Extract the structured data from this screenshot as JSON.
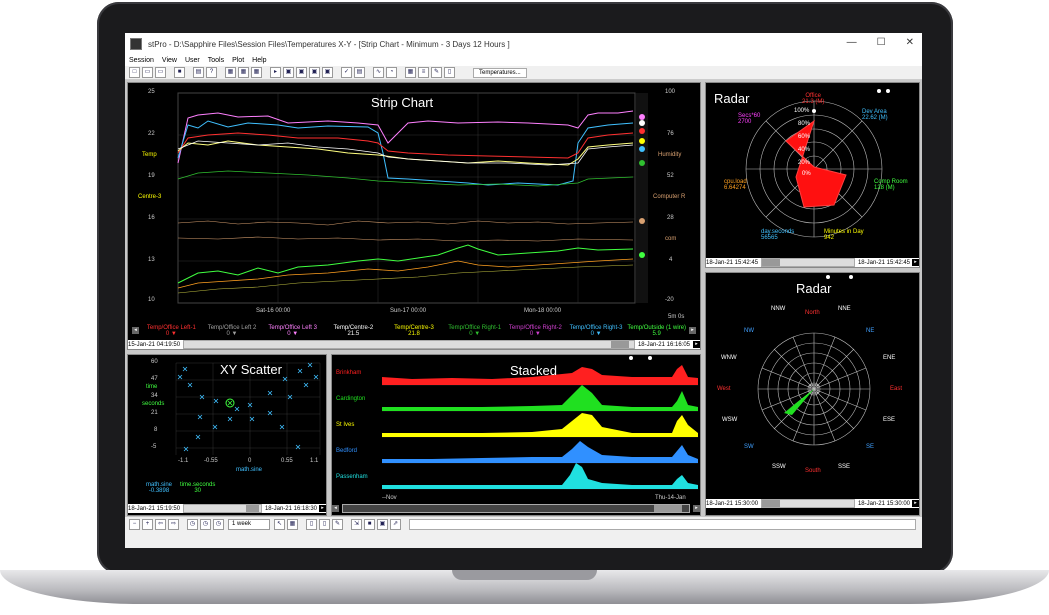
{
  "window": {
    "title": "stPro - D:\\Sapphire Files\\Session Files\\Temperatures X-Y - [Strip Chart - Minimum - 3 Days 12 Hours ]",
    "min": "—",
    "max": "☐",
    "close": "✕"
  },
  "menu": [
    "Session",
    "View",
    "User",
    "Tools",
    "Plot",
    "Help"
  ],
  "toolbar": {
    "tab_label": "Temperatures..."
  },
  "strip": {
    "title": "Strip Chart",
    "y_left_ticks": [
      "25",
      "22",
      "19",
      "16",
      "13",
      "10"
    ],
    "y_right_ticks": [
      "100",
      "76",
      "52",
      "28",
      "4",
      "-20"
    ],
    "left_labels": [
      {
        "text": "Temp",
        "color": "#ffff00"
      },
      {
        "text": "Centre-3",
        "color": "#ffff00"
      }
    ],
    "right_labels": [
      {
        "text": "Humidity",
        "color": "#d8a070"
      },
      {
        "text": "Computer R",
        "color": "#d8a070"
      },
      {
        "text": "com",
        "color": "#d8a070"
      }
    ],
    "x_ticks": [
      "Sat-16 00:00",
      "Sun-17 00:00",
      "Mon-18 00:00"
    ],
    "scale_label": "5m 0s",
    "legend": [
      {
        "name": "Temp/Office Left-1",
        "value": "0 ▼",
        "color": "#ff3030"
      },
      {
        "name": "Temp/Office Left 2",
        "value": "0 ▼",
        "color": "#a0a0a0"
      },
      {
        "name": "Temp/Office Left 3",
        "value": "0 ▼",
        "color": "#ff80ff"
      },
      {
        "name": "Temp/Centre-2",
        "value": "21.5",
        "color": "#ffffff"
      },
      {
        "name": "Temp/Centre-3",
        "value": "21.8",
        "color": "#ffff00"
      },
      {
        "name": "Temp/Office Right-1",
        "value": "0 ▼",
        "color": "#30c030"
      },
      {
        "name": "Temp/Office Right-2",
        "value": "0 ▼",
        "color": "#d040d0"
      },
      {
        "name": "Temp/Office Right-3",
        "value": "0 ▼",
        "color": "#40c0ff"
      },
      {
        "name": "Temp/Outside (1 wire)",
        "value": "5.9",
        "color": "#40ff40"
      }
    ],
    "start_time": "15-Jan-21 04:19:50",
    "end_time": "18-Jan-21 16:16:05"
  },
  "radar1": {
    "title": "Radar",
    "rings": [
      "100%",
      "80%",
      "60%",
      "40%",
      "20%",
      "0%"
    ],
    "labels": [
      {
        "name": "Office",
        "value": "21.3 (M)",
        "color": "#ff3030"
      },
      {
        "name": "Dev Area",
        "value": "22.62 (M)",
        "color": "#40c0ff"
      },
      {
        "name": "Comp Room",
        "value": "128 (M)",
        "color": "#40ff40"
      },
      {
        "name": "Minutes in Day",
        "value": "942",
        "color": "#ffff00"
      },
      {
        "name": "day.seconds",
        "value": "56565",
        "color": "#40c0ff"
      },
      {
        "name": "cpu.load",
        "value": "6.64274",
        "color": "#ffa020"
      },
      {
        "name": "Secs*60",
        "value": "2700",
        "color": "#ff40ff"
      }
    ],
    "start_time": "18-Jan-21 15:42:45",
    "end_time": "18-Jan-21 15:42:45"
  },
  "radar2": {
    "title": "Radar",
    "compass": [
      {
        "text": "North",
        "color": "#ff3030"
      },
      {
        "text": "NNE",
        "color": "#ffffff"
      },
      {
        "text": "NE",
        "color": "#40a0ff"
      },
      {
        "text": "ENE",
        "color": "#ffffff"
      },
      {
        "text": "East",
        "color": "#ff3030"
      },
      {
        "text": "ESE",
        "color": "#ffffff"
      },
      {
        "text": "SE",
        "color": "#40a0ff"
      },
      {
        "text": "SSE",
        "color": "#ffffff"
      },
      {
        "text": "South",
        "color": "#ff3030"
      },
      {
        "text": "SSW",
        "color": "#ffffff"
      },
      {
        "text": "SW",
        "color": "#40a0ff"
      },
      {
        "text": "WSW",
        "color": "#ffffff"
      },
      {
        "text": "West",
        "color": "#ff3030"
      },
      {
        "text": "WNW",
        "color": "#ffffff"
      },
      {
        "text": "NW",
        "color": "#40a0ff"
      },
      {
        "text": "NNW",
        "color": "#ffffff"
      }
    ],
    "start_time": "18-Jan-21 15:30:00",
    "end_time": "18-Jan-21 15:30:00"
  },
  "scatter": {
    "title": "XY Scatter",
    "y_ticks": [
      "60",
      "47",
      "34",
      "21",
      "8",
      "-5"
    ],
    "x_ticks": [
      "-1.1",
      "-0.55",
      "0",
      "0.55",
      "1.1"
    ],
    "ylabel_1": "time",
    "ylabel_2": "seconds",
    "xlabel": "math.sine",
    "readout_x_name": "math.sine",
    "readout_x_value": "-0.3898",
    "readout_y_name": "time.seconds",
    "readout_y_value": "30",
    "start_time": "18-Jan-21 15:19:50",
    "end_time": "18-Jan-21 16:18:30"
  },
  "stacked": {
    "title": "Stacked",
    "rows": [
      {
        "name": "Brinkham",
        "color": "#ff2020"
      },
      {
        "name": "Cardington",
        "color": "#20e020"
      },
      {
        "name": "St Ives",
        "color": "#ffff00"
      },
      {
        "name": "Bedford",
        "color": "#3090ff"
      },
      {
        "name": "Passenham",
        "color": "#20e0e0"
      }
    ],
    "x_start": "--Nov",
    "x_end": "Thu-14-Jan"
  },
  "bottom": {
    "range": "1 week"
  }
}
